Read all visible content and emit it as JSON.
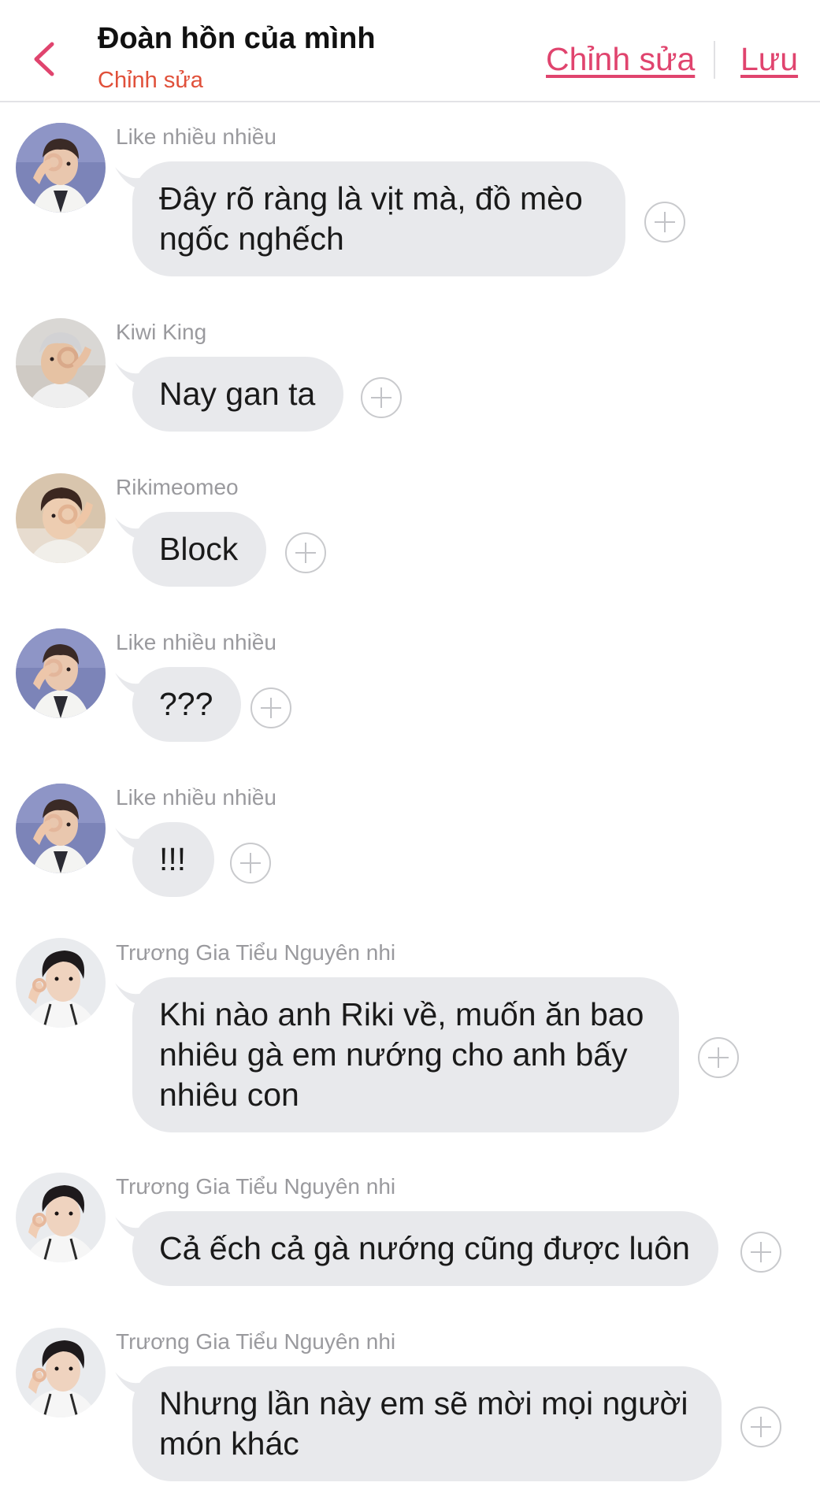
{
  "header": {
    "title": "Đoàn hồn của mình",
    "subtitle": "Chỉnh sửa",
    "edit_label": "Chỉnh sửa",
    "save_label": "Lưu",
    "back_icon": "chevron-left-icon",
    "accent_color": "#e0446e",
    "subtitle_color": "#e0503a"
  },
  "messages": [
    {
      "sender": "Like nhiều nhiều",
      "text": "Đây rõ ràng là vịt mà, đồ mèo ngốc nghếch",
      "avatar": "avatar-purple"
    },
    {
      "sender": "Kiwi King",
      "text": "Nay gan ta",
      "avatar": "avatar-silver"
    },
    {
      "sender": "Rikimeomeo",
      "text": "Block",
      "avatar": "avatar-brown"
    },
    {
      "sender": "Like nhiều nhiều",
      "text": "???",
      "avatar": "avatar-purple"
    },
    {
      "sender": "Like nhiều nhiều",
      "text": "!!!",
      "avatar": "avatar-purple"
    },
    {
      "sender": "Trương Gia Tiểu Nguyên nhi",
      "text": "Khi nào anh Riki về, muốn ăn bao nhiêu gà em nướng cho anh bấy nhiêu con",
      "avatar": "avatar-dark"
    },
    {
      "sender": "Trương Gia Tiểu Nguyên nhi",
      "text": "Cả ếch cả gà nướng cũng được luôn",
      "avatar": "avatar-dark"
    },
    {
      "sender": "Trương Gia Tiểu Nguyên nhi",
      "text": "Nhưng lần này em sẽ mời mọi người món khác",
      "avatar": "avatar-dark"
    }
  ],
  "colors": {
    "bubble": "#e8e9ec",
    "sender_text": "#9a9a9e",
    "react_icon": "#c2c3c7"
  },
  "icons": {
    "reaction": "add-reaction-icon"
  }
}
